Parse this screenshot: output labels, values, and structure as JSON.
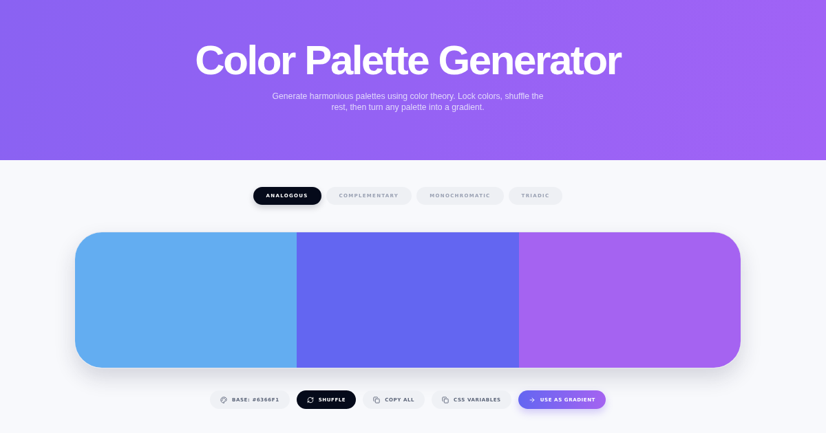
{
  "hero": {
    "title": "Color Palette Generator",
    "subtitle": "Generate harmonious palettes using color theory. Lock colors, shuffle the rest, then turn any palette into a gradient."
  },
  "tabs": [
    {
      "label": "ANALOGOUS",
      "selected": true
    },
    {
      "label": "COMPLEMENTARY",
      "selected": false
    },
    {
      "label": "MONOCHROMATIC",
      "selected": false
    },
    {
      "label": "TRIADIC",
      "selected": false
    }
  ],
  "swatches": [
    {
      "color": "#63adf1"
    },
    {
      "color": "#6366f1"
    },
    {
      "color": "#a563f1"
    }
  ],
  "actions": [
    {
      "kind": "ghost",
      "label": "BASE: #6366F1"
    },
    {
      "kind": "dark",
      "label": "SHUFFLE"
    },
    {
      "kind": "ghost",
      "label": "COPY ALL"
    },
    {
      "kind": "ghost",
      "label": "CSS VARIABLES"
    },
    {
      "kind": "gradient",
      "label": "USE AS GRADIENT"
    }
  ]
}
